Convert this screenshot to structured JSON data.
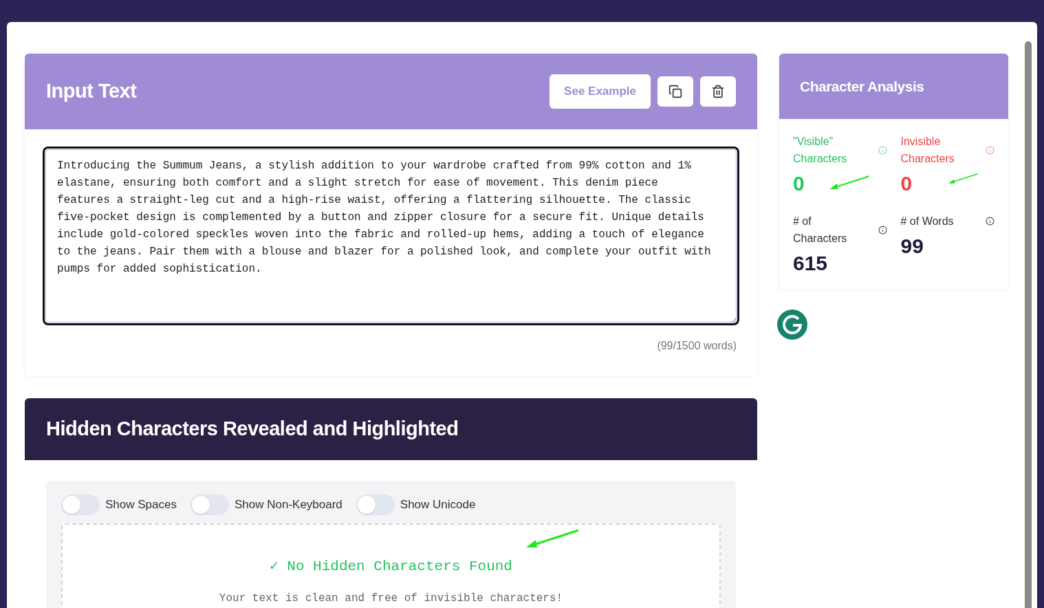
{
  "input_card": {
    "title": "Input Text",
    "example_button": "See Example",
    "text": "Introducing the Summum Jeans, a stylish addition to your wardrobe crafted from 99% cotton and 1% elastane, ensuring both comfort and a slight stretch for ease of movement. This denim piece features a straight-leg cut and a high-rise waist, offering a flattering silhouette. The classic five-pocket design is complemented by a button and zipper closure for a secure fit. Unique details include gold-colored speckles woven into the fabric and rolled-up hems, adding a touch of elegance to the jeans. Pair them with a blouse and blazer for a polished look, and complete your outfit with pumps for added sophistication.",
    "word_count": "(99/1500 words)"
  },
  "hidden_section": {
    "title": "Hidden Characters Revealed and Highlighted",
    "toggles": [
      {
        "label": "Show Spaces",
        "on": false
      },
      {
        "label": "Show Non-Keyboard",
        "on": false
      },
      {
        "label": "Show Unicode",
        "on": false
      }
    ],
    "result_title": "✓ No Hidden Characters Found",
    "result_text": "Your text is clean and free of invisible characters!"
  },
  "analysis": {
    "title": "Character Analysis",
    "stats": [
      {
        "label": "\"Visible\" Characters",
        "value": "0",
        "color": "#22c55e"
      },
      {
        "label": "Invisible Characters",
        "value": "0",
        "color": "#ef4444"
      },
      {
        "label": "# of Characters",
        "value": "615",
        "color": "#1e1b3a"
      },
      {
        "label": "# of Words",
        "value": "99",
        "color": "#1e1b3a"
      }
    ]
  }
}
